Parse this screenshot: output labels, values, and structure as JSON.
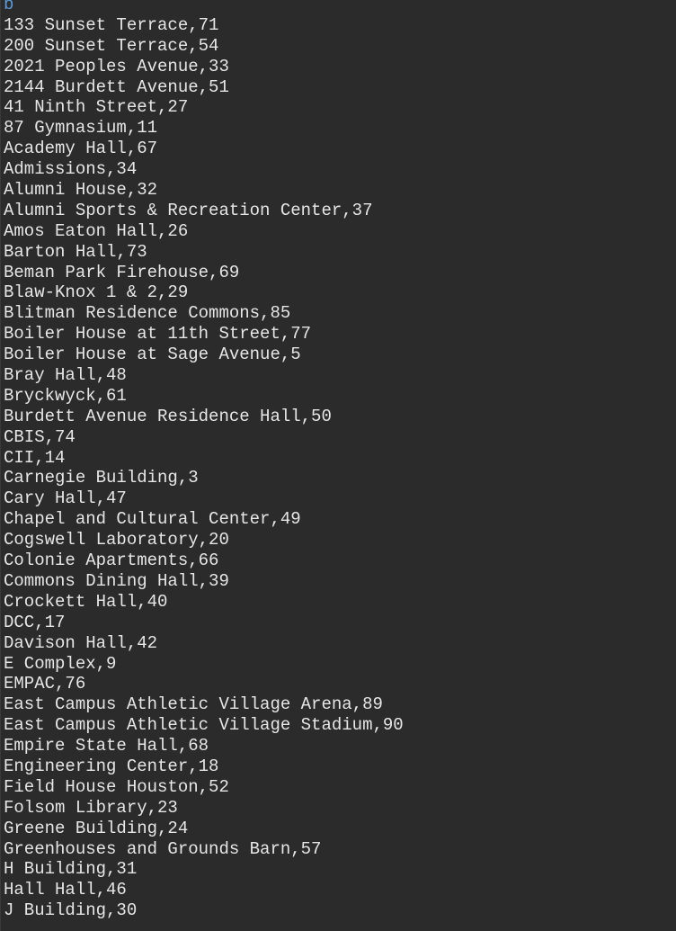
{
  "header": "b",
  "rows": [
    "133 Sunset Terrace,71",
    "200 Sunset Terrace,54",
    "2021 Peoples Avenue,33",
    "2144 Burdett Avenue,51",
    "41 Ninth Street,27",
    "87 Gymnasium,11",
    "Academy Hall,67",
    "Admissions,34",
    "Alumni House,32",
    "Alumni Sports & Recreation Center,37",
    "Amos Eaton Hall,26",
    "Barton Hall,73",
    "Beman Park Firehouse,69",
    "Blaw-Knox 1 & 2,29",
    "Blitman Residence Commons,85",
    "Boiler House at 11th Street,77",
    "Boiler House at Sage Avenue,5",
    "Bray Hall,48",
    "Bryckwyck,61",
    "Burdett Avenue Residence Hall,50",
    "CBIS,74",
    "CII,14",
    "Carnegie Building,3",
    "Cary Hall,47",
    "Chapel and Cultural Center,49",
    "Cogswell Laboratory,20",
    "Colonie Apartments,66",
    "Commons Dining Hall,39",
    "Crockett Hall,40",
    "DCC,17",
    "Davison Hall,42",
    "E Complex,9",
    "EMPAC,76",
    "East Campus Athletic Village Arena,89",
    "East Campus Athletic Village Stadium,90",
    "Empire State Hall,68",
    "Engineering Center,18",
    "Field House Houston,52",
    "Folsom Library,23",
    "Greene Building,24",
    "Greenhouses and Grounds Barn,57",
    "H Building,31",
    "Hall Hall,46",
    "J Building,30"
  ],
  "colors": {
    "background": "#2b2b2b",
    "text": "#e6e6e6",
    "header_text": "#5b9bd5"
  }
}
